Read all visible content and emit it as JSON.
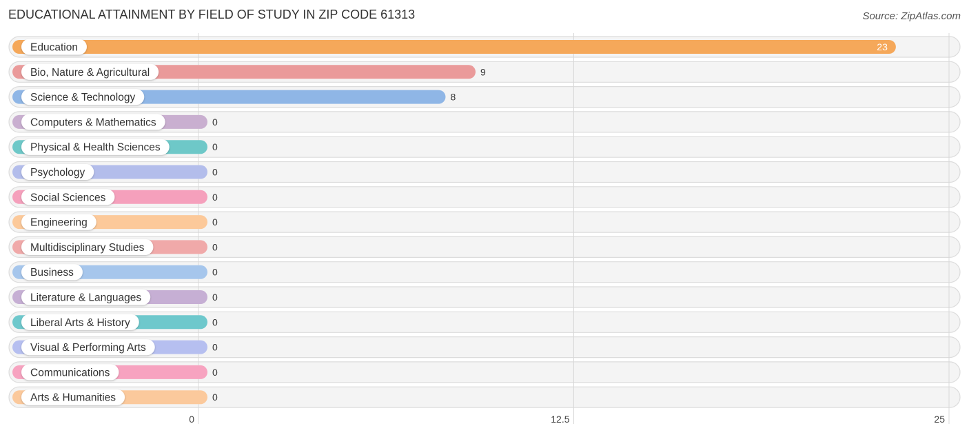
{
  "header": {
    "title": "EDUCATIONAL ATTAINMENT BY FIELD OF STUDY IN ZIP CODE 61313",
    "source": "Source: ZipAtlas.com"
  },
  "chart_data": {
    "type": "bar",
    "orientation": "horizontal",
    "title": "EDUCATIONAL ATTAINMENT BY FIELD OF STUDY IN ZIP CODE 61313",
    "xlabel": "",
    "ylabel": "",
    "xlim": [
      0,
      25
    ],
    "ticks": [
      0,
      12.5,
      25
    ],
    "tick_labels": [
      "0",
      "12.5",
      "25"
    ],
    "grid": true,
    "categories": [
      "Education",
      "Bio, Nature & Agricultural",
      "Science & Technology",
      "Computers & Mathematics",
      "Physical & Health Sciences",
      "Psychology",
      "Social Sciences",
      "Engineering",
      "Multidisciplinary Studies",
      "Business",
      "Literature & Languages",
      "Liberal Arts & History",
      "Visual & Performing Arts",
      "Communications",
      "Arts & Humanities"
    ],
    "values": [
      23,
      9,
      8,
      0,
      0,
      0,
      0,
      0,
      0,
      0,
      0,
      0,
      0,
      0,
      0
    ],
    "value_labels": [
      "23",
      "9",
      "8",
      "0",
      "0",
      "0",
      "0",
      "0",
      "0",
      "0",
      "0",
      "0",
      "0",
      "0",
      "0"
    ],
    "colors": [
      "#f5a85a",
      "#ea9a9a",
      "#8fb6e6",
      "#c9afd0",
      "#6ec8c8",
      "#b3bdeb",
      "#f5a0bc",
      "#fcc99a",
      "#f0a9a9",
      "#a6c6ec",
      "#c6afd4",
      "#6ec8cc",
      "#b6bff0",
      "#f7a3c0",
      "#fbc99c"
    ]
  }
}
